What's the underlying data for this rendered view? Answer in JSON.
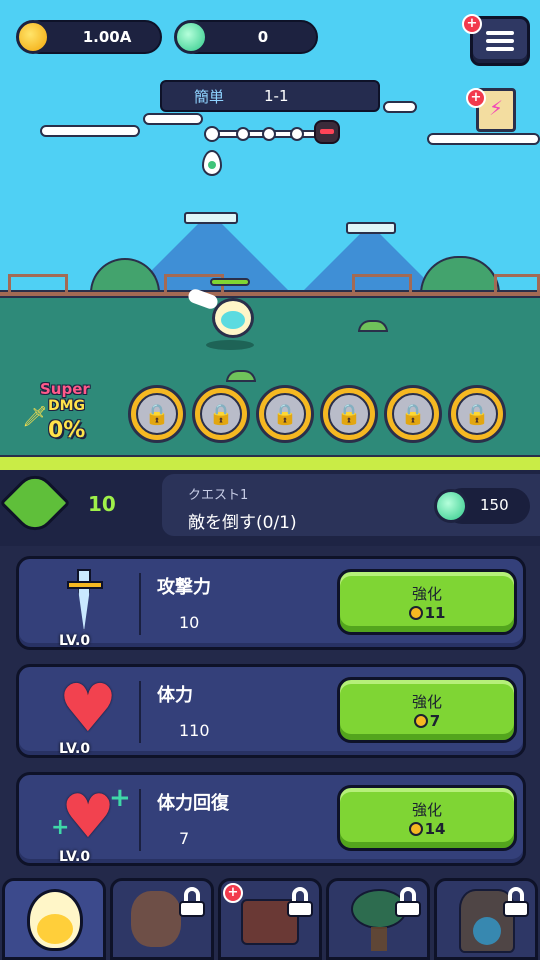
{
  "hud": {
    "gold": "1.00A",
    "gems": "0",
    "stage_difficulty": "簡単",
    "stage_number": "1-1"
  },
  "battle": {
    "super_dmg_line1": "Super",
    "super_dmg_line2": "DMG",
    "super_dmg_percent": "0%"
  },
  "quest": {
    "level": "10",
    "title": "クエスト1",
    "description": "敵を倒す(0/1)",
    "reward": "150"
  },
  "upgrades": [
    {
      "name": "攻撃力",
      "value": "10",
      "level": "LV.0",
      "button": "強化",
      "cost": "11",
      "icon": "sword-icon"
    },
    {
      "name": "体力",
      "value": "110",
      "level": "LV.0",
      "button": "強化",
      "cost": "7",
      "icon": "heart-icon"
    },
    {
      "name": "体力回復",
      "value": "7",
      "level": "LV.0",
      "button": "強化",
      "cost": "14",
      "icon": "heart-heal-icon"
    }
  ],
  "tabs": [
    {
      "icon": "fire-spirit-icon",
      "locked": false
    },
    {
      "icon": "squirrel-icon",
      "locked": true
    },
    {
      "icon": "treasure-chest-icon",
      "locked": true
    },
    {
      "icon": "tree-icon",
      "locked": true
    },
    {
      "icon": "armored-knight-icon",
      "locked": true
    }
  ],
  "colors": {
    "upgrade_button": "#7fd534",
    "sky": "#4fd0f4",
    "panel": "#34407a"
  }
}
